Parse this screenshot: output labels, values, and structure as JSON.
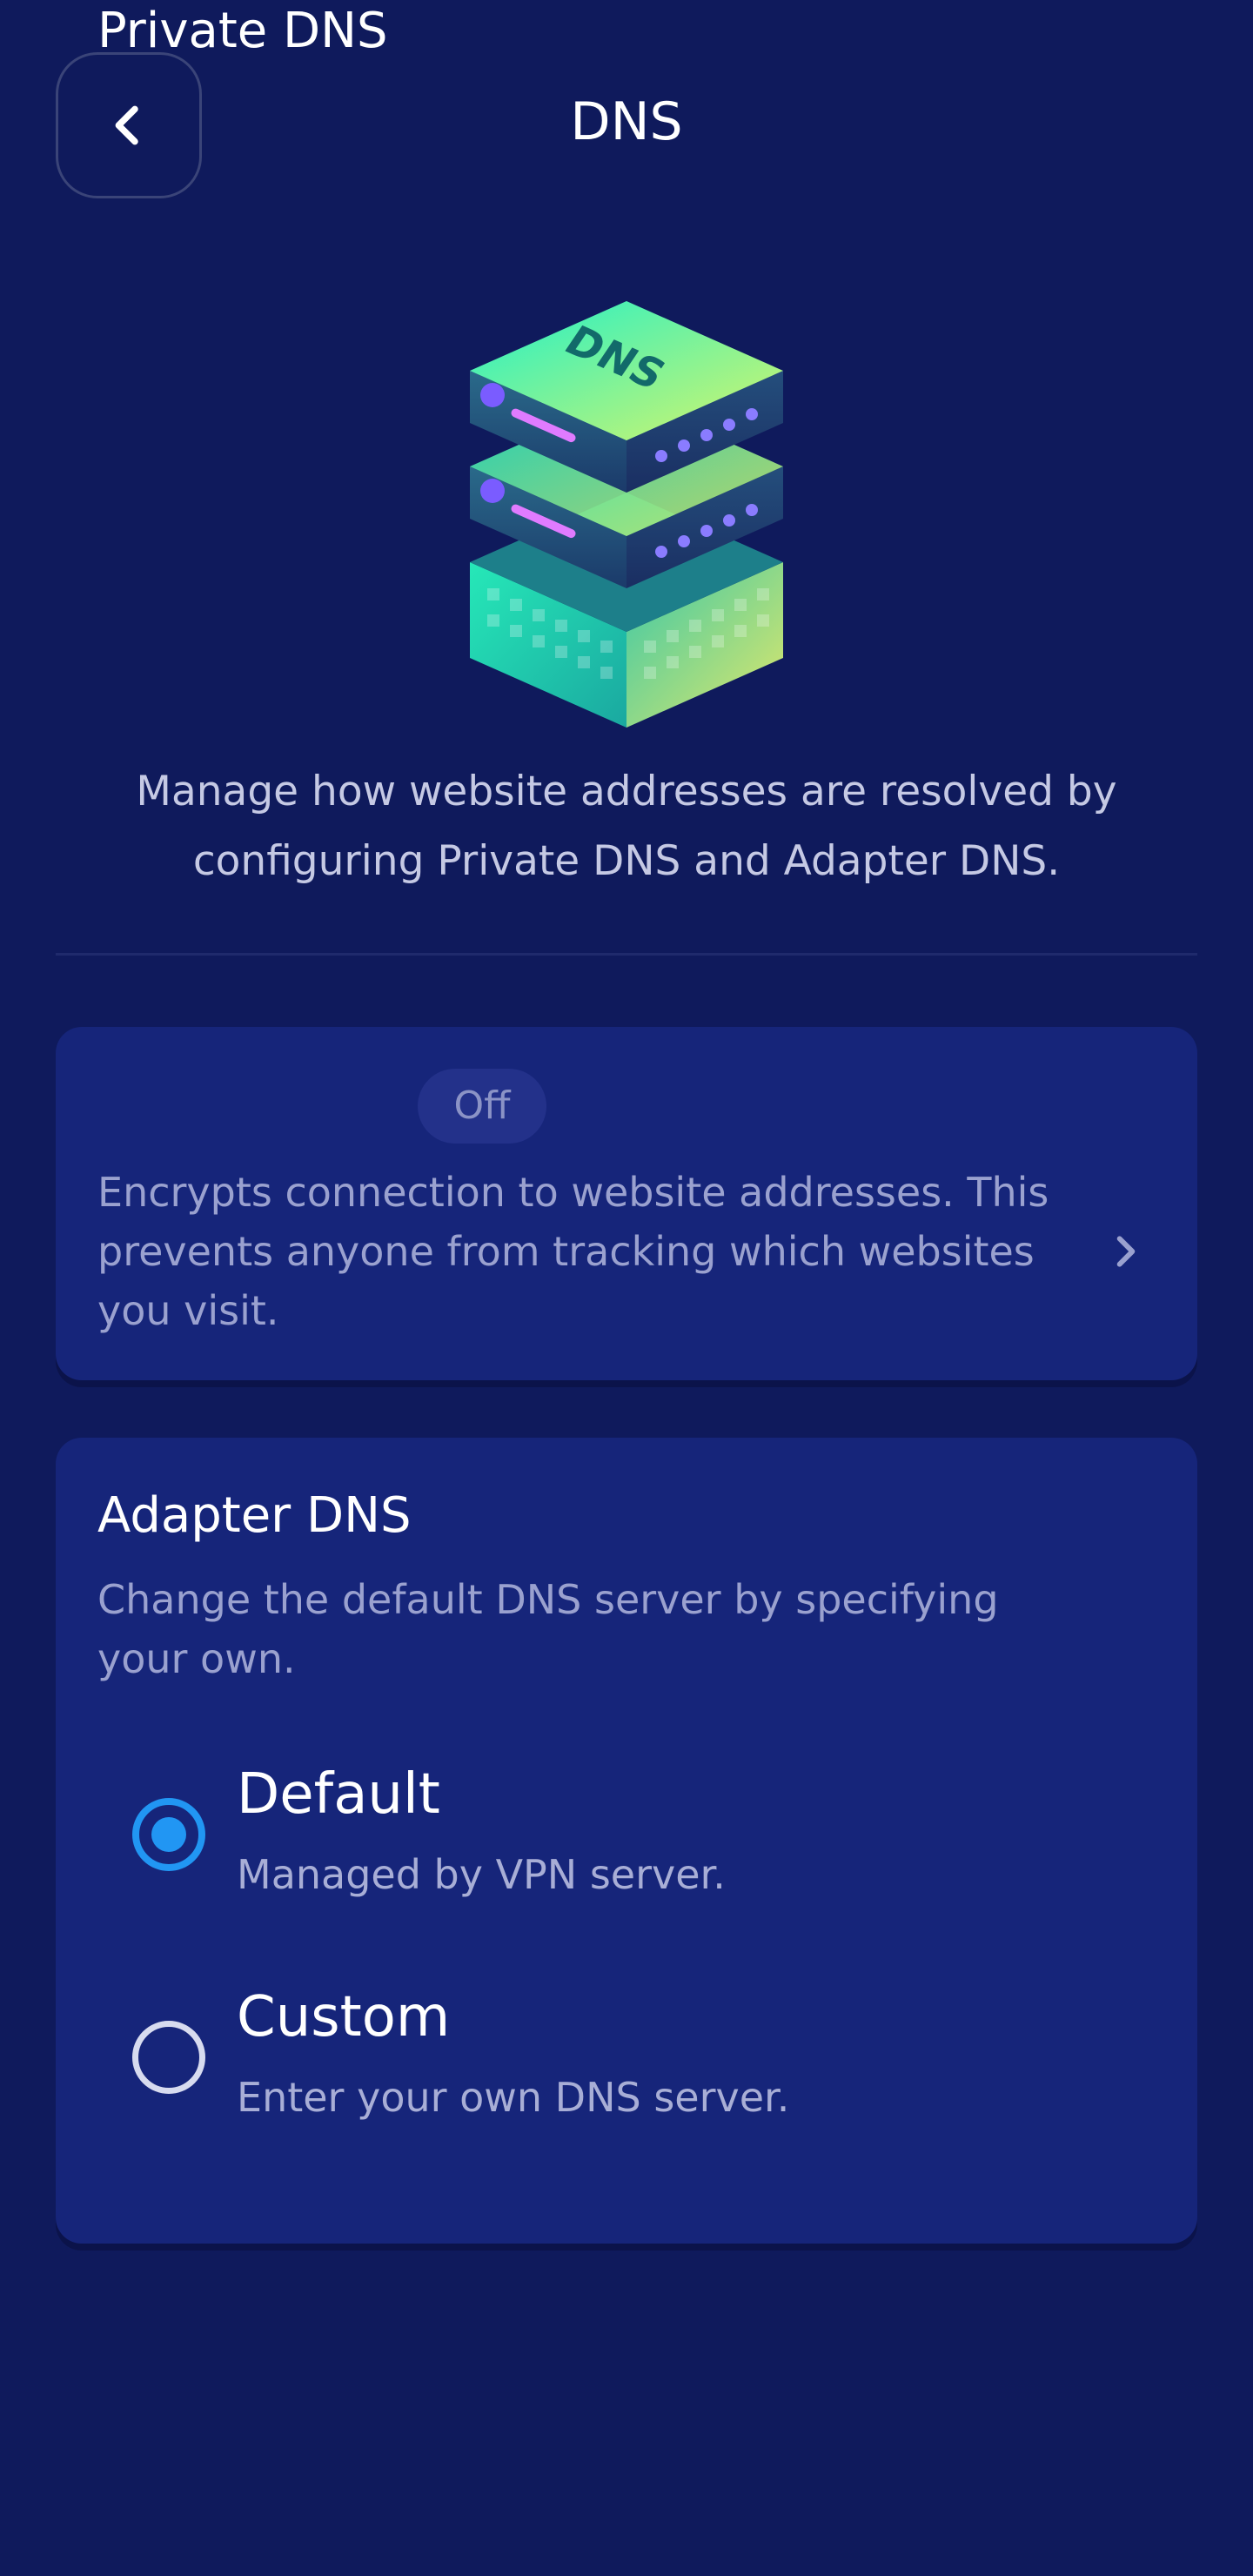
{
  "header": {
    "title": "DNS",
    "back_icon": "chevron-left-icon"
  },
  "hero": {
    "illustration": "dns-server-stack-illustration",
    "illustration_text": "DNS",
    "description": "Manage how website addresses are resolved by configuring Private DNS and Adapter DNS."
  },
  "private_dns": {
    "title": "Private DNS",
    "status": "Off",
    "description": "Encrypts connection to website addresses. This prevents anyone from tracking which websites you visit.",
    "chevron_icon": "chevron-right-icon"
  },
  "adapter_dns": {
    "title": "Adapter DNS",
    "description": "Change the default DNS server by specifying your own.",
    "options": [
      {
        "label": "Default",
        "sublabel": "Managed by VPN server.",
        "selected": true
      },
      {
        "label": "Custom",
        "sublabel": "Enter your own DNS server.",
        "selected": false
      }
    ]
  },
  "colors": {
    "background": "#0f1a5c",
    "card": "#16257a",
    "accent": "#2196f3",
    "muted_text": "#9aa1cf"
  }
}
